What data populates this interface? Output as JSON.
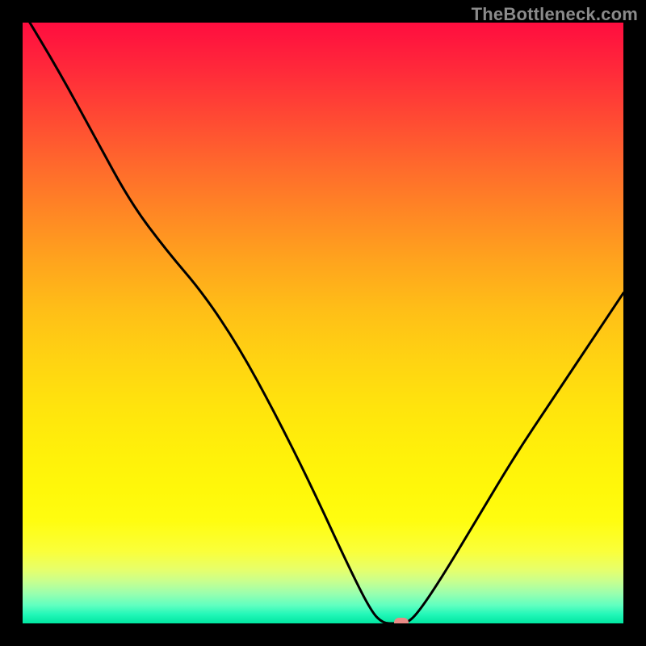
{
  "watermark": "TheBottleneck.com",
  "marker": {
    "x_frac": 0.63,
    "y_frac": 0.998
  },
  "chart_data": {
    "type": "line",
    "title": "",
    "xlabel": "",
    "ylabel": "",
    "xlim": [
      0,
      100
    ],
    "ylim": [
      0,
      100
    ],
    "series": [
      {
        "name": "bottleneck-curve",
        "x": [
          0,
          6,
          12,
          18,
          24,
          30,
          36,
          42,
          48,
          54,
          58,
          60,
          62,
          64,
          66,
          70,
          76,
          82,
          88,
          94,
          100
        ],
        "y": [
          102,
          92,
          81,
          70,
          62,
          55,
          46,
          35,
          23,
          10,
          2,
          0,
          0,
          0,
          2,
          8,
          18,
          28,
          37,
          46,
          55
        ]
      }
    ],
    "annotations": [
      {
        "type": "marker",
        "x": 63,
        "y": 0,
        "label": "optimal-point"
      }
    ],
    "background_gradient": {
      "top": "#ff0d3f",
      "mid": "#ffe40d",
      "bottom": "#00e6a1"
    }
  }
}
